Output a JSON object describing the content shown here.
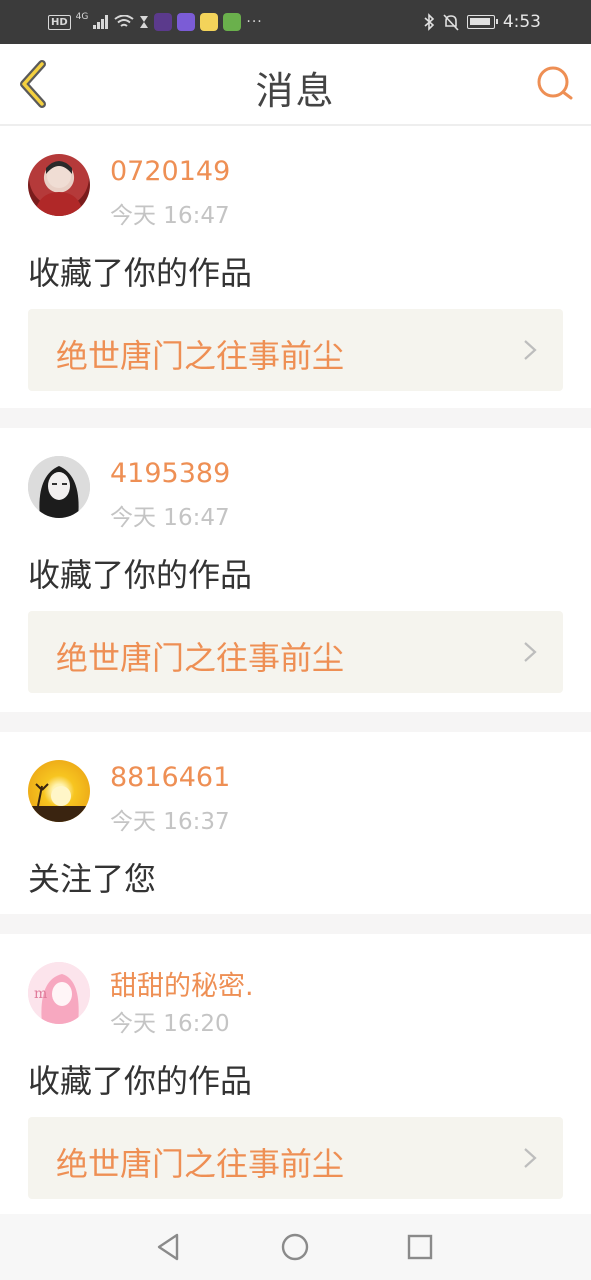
{
  "status_bar": {
    "network_badge": "HD",
    "signal_label": "4G",
    "time": "4:53",
    "battery_level": 0.85,
    "more": "···"
  },
  "header": {
    "title": "消息"
  },
  "colors": {
    "accent": "#ee8f54",
    "card_bg": "#f5f4ee",
    "divider": "#f6f5f5"
  },
  "messages": [
    {
      "username": "0720149",
      "time": "今天 16:47",
      "action": "收藏了你的作品",
      "work_title": "绝世唐门之往事前尘"
    },
    {
      "username": "4195389",
      "time": "今天 16:47",
      "action": "收藏了你的作品",
      "work_title": "绝世唐门之往事前尘"
    },
    {
      "username": "8816461",
      "time": "今天 16:37",
      "action": "关注了您"
    },
    {
      "username": "甜甜的秘密.",
      "time": "今天 16:20",
      "action": "收藏了你的作品",
      "work_title": "绝世唐门之往事前尘"
    }
  ]
}
